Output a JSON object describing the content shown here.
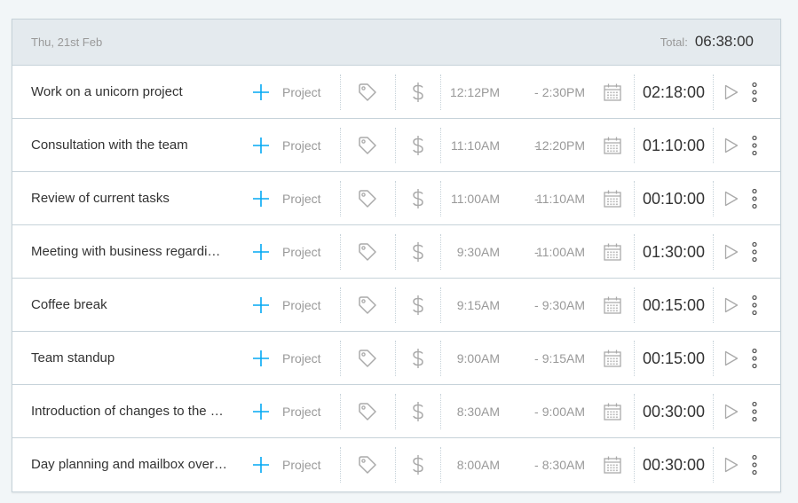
{
  "header": {
    "date": "Thu, 21st Feb",
    "total_label": "Total:",
    "total_value": "06:38:00"
  },
  "colors": {
    "accent": "#03a9f4",
    "icon_gray": "#999999",
    "border": "#c6d2d9",
    "header_bg": "#e4eaee"
  },
  "icons": {
    "add_project": "plus-icon",
    "tag": "tag-icon",
    "billable": "dollar-icon",
    "date": "calendar-icon",
    "start": "play-icon",
    "more": "more-vertical-icon"
  },
  "entries": [
    {
      "description": "Work on a unicorn project",
      "project": "Project",
      "start": "12:12PM",
      "dash": "-",
      "end": "2:30PM",
      "duration": "02:18:00"
    },
    {
      "description": "Consultation with the team",
      "project": "Project",
      "start": "11:10AM",
      "dash": "-",
      "end": "12:20PM",
      "duration": "01:10:00"
    },
    {
      "description": "Review of current tasks",
      "project": "Project",
      "start": "11:00AM",
      "dash": "-",
      "end": "11:10AM",
      "duration": "00:10:00"
    },
    {
      "description": "Meeting with business regardi…",
      "project": "Project",
      "start": "9:30AM",
      "dash": "-",
      "end": "11:00AM",
      "duration": "01:30:00"
    },
    {
      "description": "Coffee break",
      "project": "Project",
      "start": "9:15AM",
      "dash": "-",
      "end": "9:30AM",
      "duration": "00:15:00"
    },
    {
      "description": "Team standup",
      "project": "Project",
      "start": "9:00AM",
      "dash": "-",
      "end": "9:15AM",
      "duration": "00:15:00"
    },
    {
      "description": "Introduction of changes to the …",
      "project": "Project",
      "start": "8:30AM",
      "dash": "-",
      "end": "9:00AM",
      "duration": "00:30:00"
    },
    {
      "description": "Day planning and mailbox over…",
      "project": "Project",
      "start": "8:00AM",
      "dash": "-",
      "end": "8:30AM",
      "duration": "00:30:00"
    }
  ]
}
